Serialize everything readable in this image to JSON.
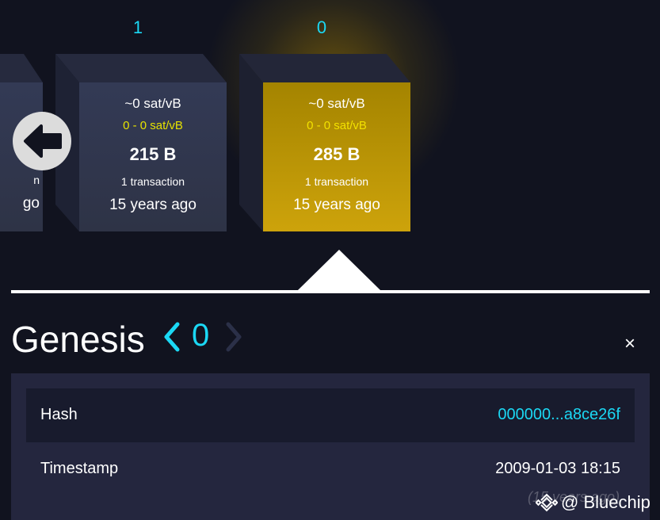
{
  "blocks": [
    {
      "height": "",
      "fee": "",
      "fee_range": "",
      "size": "",
      "tx_count": "n",
      "age": "go"
    },
    {
      "height": "1",
      "fee": "~0 sat/vB",
      "fee_range": "0 - 0 sat/vB",
      "size": "215 B",
      "tx_count": "1 transaction",
      "age": "15 years ago"
    },
    {
      "height": "0",
      "fee": "~0 sat/vB",
      "fee_range": "0 - 0 sat/vB",
      "size": "285 B",
      "tx_count": "1 transaction",
      "age": "15 years ago",
      "selected": true
    }
  ],
  "detail": {
    "title": "Genesis",
    "height": "0",
    "close_label": "×",
    "rows": [
      {
        "label": "Hash",
        "value": "000000...a8ce26f"
      },
      {
        "label": "Timestamp",
        "value": "2009-01-03 18:15"
      }
    ],
    "faded_text": "(15 years ago)"
  },
  "watermark": {
    "text": "@ Bluechip"
  },
  "colors": {
    "background": "#11131f",
    "accent": "#1bd8f4",
    "selected_block": "#cda30b",
    "fee_range": "#e6e200",
    "panel": "#24263e"
  },
  "icons": [
    "arrow-left-icon",
    "chevron-left-icon",
    "chevron-right-icon",
    "close-icon",
    "binance-logo-icon"
  ]
}
